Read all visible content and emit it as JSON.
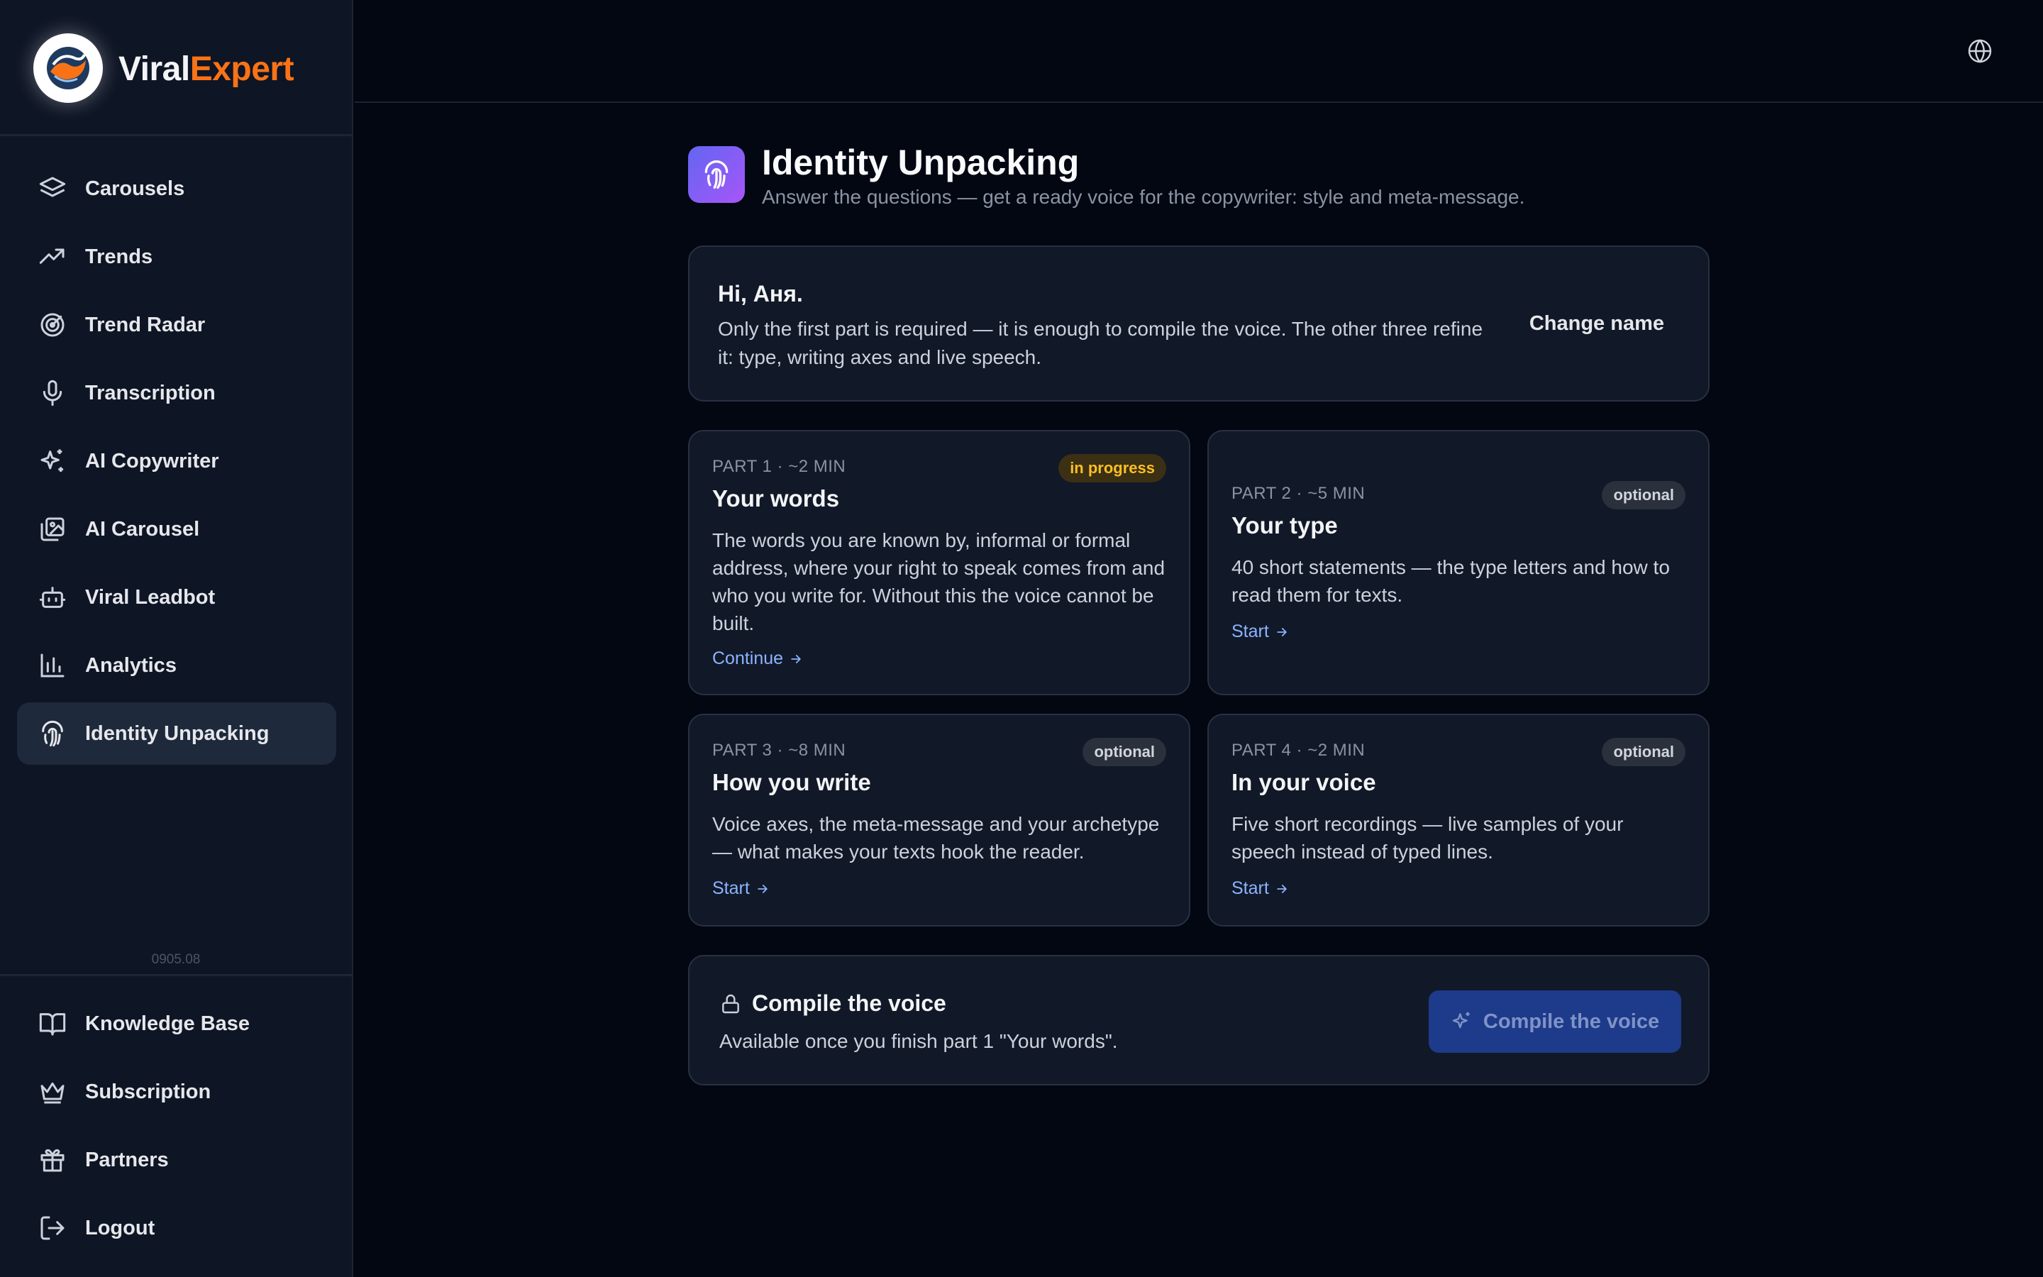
{
  "brand": {
    "name_part1": "Viral",
    "name_part2": "Expert"
  },
  "nav": {
    "items": [
      {
        "label": "Carousels",
        "icon": "layers-icon"
      },
      {
        "label": "Trends",
        "icon": "trending-up-icon"
      },
      {
        "label": "Trend Radar",
        "icon": "radar-icon"
      },
      {
        "label": "Transcription",
        "icon": "microphone-icon"
      },
      {
        "label": "AI Copywriter",
        "icon": "sparkles-icon"
      },
      {
        "label": "AI Carousel",
        "icon": "images-icon"
      },
      {
        "label": "Viral Leadbot",
        "icon": "bot-icon"
      },
      {
        "label": "Analytics",
        "icon": "bar-chart-icon"
      },
      {
        "label": "Identity Unpacking",
        "icon": "fingerprint-icon",
        "active": true
      }
    ],
    "bottom_items": [
      {
        "label": "Knowledge Base",
        "icon": "book-icon"
      },
      {
        "label": "Subscription",
        "icon": "crown-icon"
      },
      {
        "label": "Partners",
        "icon": "gift-icon"
      },
      {
        "label": "Logout",
        "icon": "logout-icon"
      }
    ],
    "version": "0905.08"
  },
  "page": {
    "title": "Identity Unpacking",
    "subtitle": "Answer the questions — get a ready voice for the copywriter: style and meta-message."
  },
  "greeting": {
    "title": "Hi, Аня.",
    "text": "Only the first part is required — it is enough to compile the voice. The other three refine it: type, writing axes and live speech.",
    "change_name": "Change name"
  },
  "parts": [
    {
      "meta": "PART 1 · ~2 MIN",
      "title": "Your words",
      "badge": "in progress",
      "description": "The words you are known by, informal or formal address, where your right to speak comes from and who you write for. Without this the voice cannot be built.",
      "action": "Continue"
    },
    {
      "meta": "PART 2 · ~5 MIN",
      "title": "Your type",
      "badge": "optional",
      "description": "40 short statements — the type letters and how to read them for texts.",
      "action": "Start"
    },
    {
      "meta": "PART 3 · ~8 MIN",
      "title": "How you write",
      "badge": "optional",
      "description": "Voice axes, the meta-message and your archetype — what makes your texts hook the reader.",
      "action": "Start"
    },
    {
      "meta": "PART 4 · ~2 MIN",
      "title": "In your voice",
      "badge": "optional",
      "description": "Five short recordings — live samples of your speech instead of typed lines.",
      "action": "Start"
    }
  ],
  "compile": {
    "title": "Compile the voice",
    "text": "Available once you finish part 1 \"Your words\".",
    "button": "Compile the voice"
  },
  "colors": {
    "background": "#030712",
    "sidebar": "#0e1525",
    "card": "#111827",
    "accent_orange": "#f97316",
    "link": "#8ab4ff",
    "badge_progress": "#fbbf24"
  }
}
